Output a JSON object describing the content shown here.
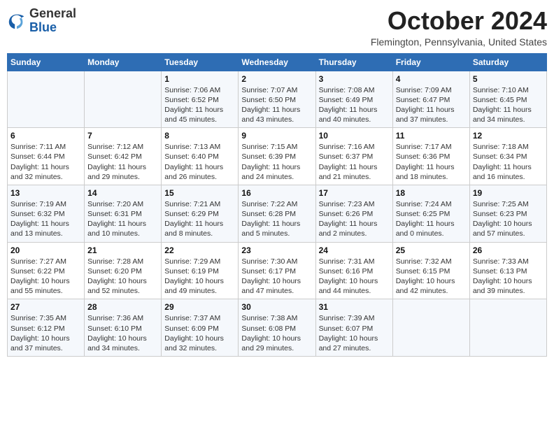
{
  "header": {
    "logo_line1": "General",
    "logo_line2": "Blue",
    "month": "October 2024",
    "location": "Flemington, Pennsylvania, United States"
  },
  "days_of_week": [
    "Sunday",
    "Monday",
    "Tuesday",
    "Wednesday",
    "Thursday",
    "Friday",
    "Saturday"
  ],
  "weeks": [
    [
      {
        "day": "",
        "sunrise": "",
        "sunset": "",
        "daylight": ""
      },
      {
        "day": "",
        "sunrise": "",
        "sunset": "",
        "daylight": ""
      },
      {
        "day": "1",
        "sunrise": "Sunrise: 7:06 AM",
        "sunset": "Sunset: 6:52 PM",
        "daylight": "Daylight: 11 hours and 45 minutes."
      },
      {
        "day": "2",
        "sunrise": "Sunrise: 7:07 AM",
        "sunset": "Sunset: 6:50 PM",
        "daylight": "Daylight: 11 hours and 43 minutes."
      },
      {
        "day": "3",
        "sunrise": "Sunrise: 7:08 AM",
        "sunset": "Sunset: 6:49 PM",
        "daylight": "Daylight: 11 hours and 40 minutes."
      },
      {
        "day": "4",
        "sunrise": "Sunrise: 7:09 AM",
        "sunset": "Sunset: 6:47 PM",
        "daylight": "Daylight: 11 hours and 37 minutes."
      },
      {
        "day": "5",
        "sunrise": "Sunrise: 7:10 AM",
        "sunset": "Sunset: 6:45 PM",
        "daylight": "Daylight: 11 hours and 34 minutes."
      }
    ],
    [
      {
        "day": "6",
        "sunrise": "Sunrise: 7:11 AM",
        "sunset": "Sunset: 6:44 PM",
        "daylight": "Daylight: 11 hours and 32 minutes."
      },
      {
        "day": "7",
        "sunrise": "Sunrise: 7:12 AM",
        "sunset": "Sunset: 6:42 PM",
        "daylight": "Daylight: 11 hours and 29 minutes."
      },
      {
        "day": "8",
        "sunrise": "Sunrise: 7:13 AM",
        "sunset": "Sunset: 6:40 PM",
        "daylight": "Daylight: 11 hours and 26 minutes."
      },
      {
        "day": "9",
        "sunrise": "Sunrise: 7:15 AM",
        "sunset": "Sunset: 6:39 PM",
        "daylight": "Daylight: 11 hours and 24 minutes."
      },
      {
        "day": "10",
        "sunrise": "Sunrise: 7:16 AM",
        "sunset": "Sunset: 6:37 PM",
        "daylight": "Daylight: 11 hours and 21 minutes."
      },
      {
        "day": "11",
        "sunrise": "Sunrise: 7:17 AM",
        "sunset": "Sunset: 6:36 PM",
        "daylight": "Daylight: 11 hours and 18 minutes."
      },
      {
        "day": "12",
        "sunrise": "Sunrise: 7:18 AM",
        "sunset": "Sunset: 6:34 PM",
        "daylight": "Daylight: 11 hours and 16 minutes."
      }
    ],
    [
      {
        "day": "13",
        "sunrise": "Sunrise: 7:19 AM",
        "sunset": "Sunset: 6:32 PM",
        "daylight": "Daylight: 11 hours and 13 minutes."
      },
      {
        "day": "14",
        "sunrise": "Sunrise: 7:20 AM",
        "sunset": "Sunset: 6:31 PM",
        "daylight": "Daylight: 11 hours and 10 minutes."
      },
      {
        "day": "15",
        "sunrise": "Sunrise: 7:21 AM",
        "sunset": "Sunset: 6:29 PM",
        "daylight": "Daylight: 11 hours and 8 minutes."
      },
      {
        "day": "16",
        "sunrise": "Sunrise: 7:22 AM",
        "sunset": "Sunset: 6:28 PM",
        "daylight": "Daylight: 11 hours and 5 minutes."
      },
      {
        "day": "17",
        "sunrise": "Sunrise: 7:23 AM",
        "sunset": "Sunset: 6:26 PM",
        "daylight": "Daylight: 11 hours and 2 minutes."
      },
      {
        "day": "18",
        "sunrise": "Sunrise: 7:24 AM",
        "sunset": "Sunset: 6:25 PM",
        "daylight": "Daylight: 11 hours and 0 minutes."
      },
      {
        "day": "19",
        "sunrise": "Sunrise: 7:25 AM",
        "sunset": "Sunset: 6:23 PM",
        "daylight": "Daylight: 10 hours and 57 minutes."
      }
    ],
    [
      {
        "day": "20",
        "sunrise": "Sunrise: 7:27 AM",
        "sunset": "Sunset: 6:22 PM",
        "daylight": "Daylight: 10 hours and 55 minutes."
      },
      {
        "day": "21",
        "sunrise": "Sunrise: 7:28 AM",
        "sunset": "Sunset: 6:20 PM",
        "daylight": "Daylight: 10 hours and 52 minutes."
      },
      {
        "day": "22",
        "sunrise": "Sunrise: 7:29 AM",
        "sunset": "Sunset: 6:19 PM",
        "daylight": "Daylight: 10 hours and 49 minutes."
      },
      {
        "day": "23",
        "sunrise": "Sunrise: 7:30 AM",
        "sunset": "Sunset: 6:17 PM",
        "daylight": "Daylight: 10 hours and 47 minutes."
      },
      {
        "day": "24",
        "sunrise": "Sunrise: 7:31 AM",
        "sunset": "Sunset: 6:16 PM",
        "daylight": "Daylight: 10 hours and 44 minutes."
      },
      {
        "day": "25",
        "sunrise": "Sunrise: 7:32 AM",
        "sunset": "Sunset: 6:15 PM",
        "daylight": "Daylight: 10 hours and 42 minutes."
      },
      {
        "day": "26",
        "sunrise": "Sunrise: 7:33 AM",
        "sunset": "Sunset: 6:13 PM",
        "daylight": "Daylight: 10 hours and 39 minutes."
      }
    ],
    [
      {
        "day": "27",
        "sunrise": "Sunrise: 7:35 AM",
        "sunset": "Sunset: 6:12 PM",
        "daylight": "Daylight: 10 hours and 37 minutes."
      },
      {
        "day": "28",
        "sunrise": "Sunrise: 7:36 AM",
        "sunset": "Sunset: 6:10 PM",
        "daylight": "Daylight: 10 hours and 34 minutes."
      },
      {
        "day": "29",
        "sunrise": "Sunrise: 7:37 AM",
        "sunset": "Sunset: 6:09 PM",
        "daylight": "Daylight: 10 hours and 32 minutes."
      },
      {
        "day": "30",
        "sunrise": "Sunrise: 7:38 AM",
        "sunset": "Sunset: 6:08 PM",
        "daylight": "Daylight: 10 hours and 29 minutes."
      },
      {
        "day": "31",
        "sunrise": "Sunrise: 7:39 AM",
        "sunset": "Sunset: 6:07 PM",
        "daylight": "Daylight: 10 hours and 27 minutes."
      },
      {
        "day": "",
        "sunrise": "",
        "sunset": "",
        "daylight": ""
      },
      {
        "day": "",
        "sunrise": "",
        "sunset": "",
        "daylight": ""
      }
    ]
  ]
}
